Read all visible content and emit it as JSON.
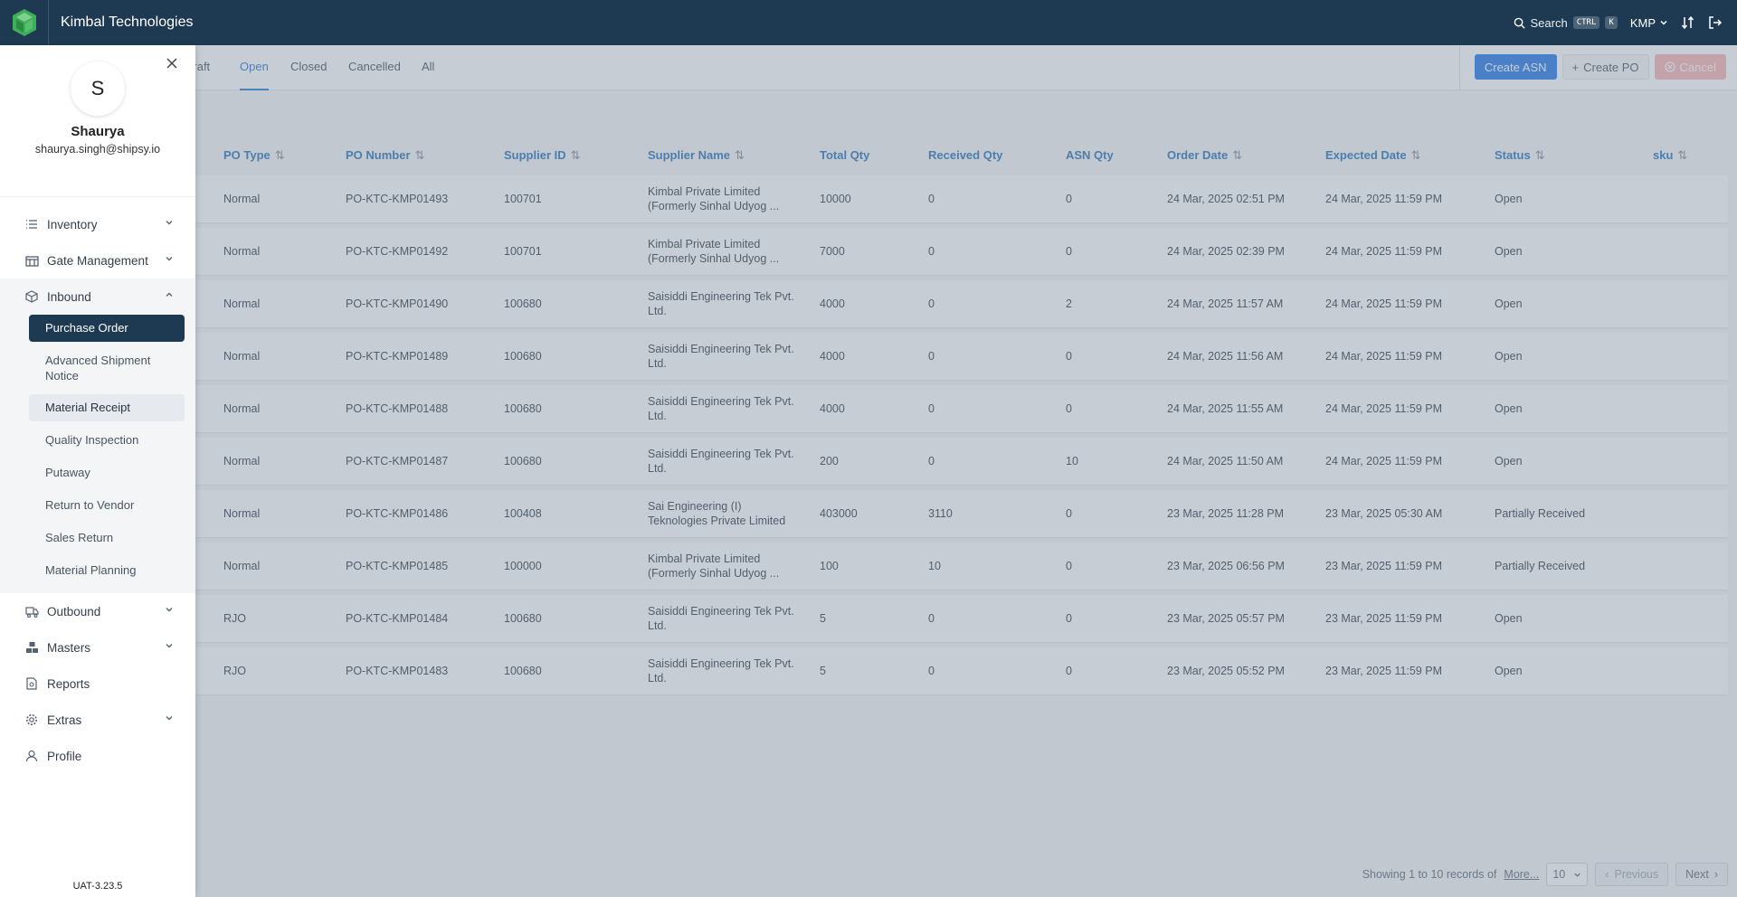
{
  "app": {
    "title": "Kimbal Technologies",
    "search_label": "Search",
    "kbd_ctrl": "CTRL",
    "kbd_k": "K",
    "org": "KMP"
  },
  "tabs": [
    "Draft",
    "Open",
    "Closed",
    "Cancelled",
    "All"
  ],
  "actions": {
    "create_asn": "Create ASN",
    "create_po": "Create PO",
    "cancel": "Cancel"
  },
  "columns": [
    "PO Type",
    "PO Number",
    "Supplier ID",
    "Supplier Name",
    "Total Qty",
    "Received Qty",
    "ASN Qty",
    "Order Date",
    "Expected Date",
    "Status",
    "sku"
  ],
  "rows": [
    {
      "type": "Normal",
      "po": "PO-KTC-KMP01493",
      "sid": "100701",
      "sname": "Kimbal Private Limited (Formerly Sinhal Udyog ...",
      "total": "10000",
      "recv": "0",
      "asn": "0",
      "order": "24 Mar, 2025 02:51 PM",
      "expected": "24 Mar, 2025 11:59 PM",
      "status": "Open"
    },
    {
      "type": "Normal",
      "po": "PO-KTC-KMP01492",
      "sid": "100701",
      "sname": "Kimbal Private Limited (Formerly Sinhal Udyog ...",
      "total": "7000",
      "recv": "0",
      "asn": "0",
      "order": "24 Mar, 2025 02:39 PM",
      "expected": "24 Mar, 2025 11:59 PM",
      "status": "Open"
    },
    {
      "type": "Normal",
      "po": "PO-KTC-KMP01490",
      "sid": "100680",
      "sname": "Saisiddi Engineering Tek Pvt. Ltd.",
      "total": "4000",
      "recv": "0",
      "asn": "2",
      "order": "24 Mar, 2025 11:57 AM",
      "expected": "24 Mar, 2025 11:59 PM",
      "status": "Open"
    },
    {
      "type": "Normal",
      "po": "PO-KTC-KMP01489",
      "sid": "100680",
      "sname": "Saisiddi Engineering Tek Pvt. Ltd.",
      "total": "4000",
      "recv": "0",
      "asn": "0",
      "order": "24 Mar, 2025 11:56 AM",
      "expected": "24 Mar, 2025 11:59 PM",
      "status": "Open"
    },
    {
      "type": "Normal",
      "po": "PO-KTC-KMP01488",
      "sid": "100680",
      "sname": "Saisiddi Engineering Tek Pvt. Ltd.",
      "total": "4000",
      "recv": "0",
      "asn": "0",
      "order": "24 Mar, 2025 11:55 AM",
      "expected": "24 Mar, 2025 11:59 PM",
      "status": "Open"
    },
    {
      "type": "Normal",
      "po": "PO-KTC-KMP01487",
      "sid": "100680",
      "sname": "Saisiddi Engineering Tek Pvt. Ltd.",
      "total": "200",
      "recv": "0",
      "asn": "10",
      "order": "24 Mar, 2025 11:50 AM",
      "expected": "24 Mar, 2025 11:59 PM",
      "status": "Open"
    },
    {
      "type": "Normal",
      "po": "PO-KTC-KMP01486",
      "sid": "100408",
      "sname": "Sai Engineering (I) Teknologies Private Limited",
      "total": "403000",
      "recv": "3110",
      "asn": "0",
      "order": "23 Mar, 2025 11:28 PM",
      "expected": "23 Mar, 2025 05:30 AM",
      "status": "Partially Received"
    },
    {
      "type": "Normal",
      "po": "PO-KTC-KMP01485",
      "sid": "100000",
      "sname": "Kimbal Private Limited (Formerly Sinhal Udyog ...",
      "total": "100",
      "recv": "10",
      "asn": "0",
      "order": "23 Mar, 2025 06:56 PM",
      "expected": "23 Mar, 2025 11:59 PM",
      "status": "Partially Received"
    },
    {
      "type": "RJO",
      "po": "PO-KTC-KMP01484",
      "sid": "100680",
      "sname": "Saisiddi Engineering Tek Pvt. Ltd.",
      "total": "5",
      "recv": "0",
      "asn": "0",
      "order": "23 Mar, 2025 05:57 PM",
      "expected": "23 Mar, 2025 11:59 PM",
      "status": "Open"
    },
    {
      "type": "RJO",
      "po": "PO-KTC-KMP01483",
      "sid": "100680",
      "sname": "Saisiddi Engineering Tek Pvt. Ltd.",
      "total": "5",
      "recv": "0",
      "asn": "0",
      "order": "23 Mar, 2025 05:52 PM",
      "expected": "23 Mar, 2025 11:59 PM",
      "status": "Open"
    }
  ],
  "pager": {
    "showing": "Showing 1 to 10 records of",
    "more": "More...",
    "page_size": "10",
    "previous": "Previous",
    "next": "Next"
  },
  "sidebar": {
    "avatar": "S",
    "name": "Shaurya",
    "email": "shaurya.singh@shipsy.io",
    "nav": {
      "inventory": "Inventory",
      "gate": "Gate Management",
      "inbound": "Inbound",
      "outbound": "Outbound",
      "masters": "Masters",
      "reports": "Reports",
      "extras": "Extras",
      "profile": "Profile"
    },
    "inbound_items": [
      "Purchase Order",
      "Advanced Shipment Notice",
      "Material Receipt",
      "Quality Inspection",
      "Putaway",
      "Return to Vendor",
      "Sales Return",
      "Material Planning"
    ],
    "version": "UAT-3.23.5"
  },
  "colors": {
    "topbar": "#1e3a52",
    "primary": "#1a73e8",
    "active_nav": "#1e3a52",
    "header_text": "#1f6fb8"
  }
}
